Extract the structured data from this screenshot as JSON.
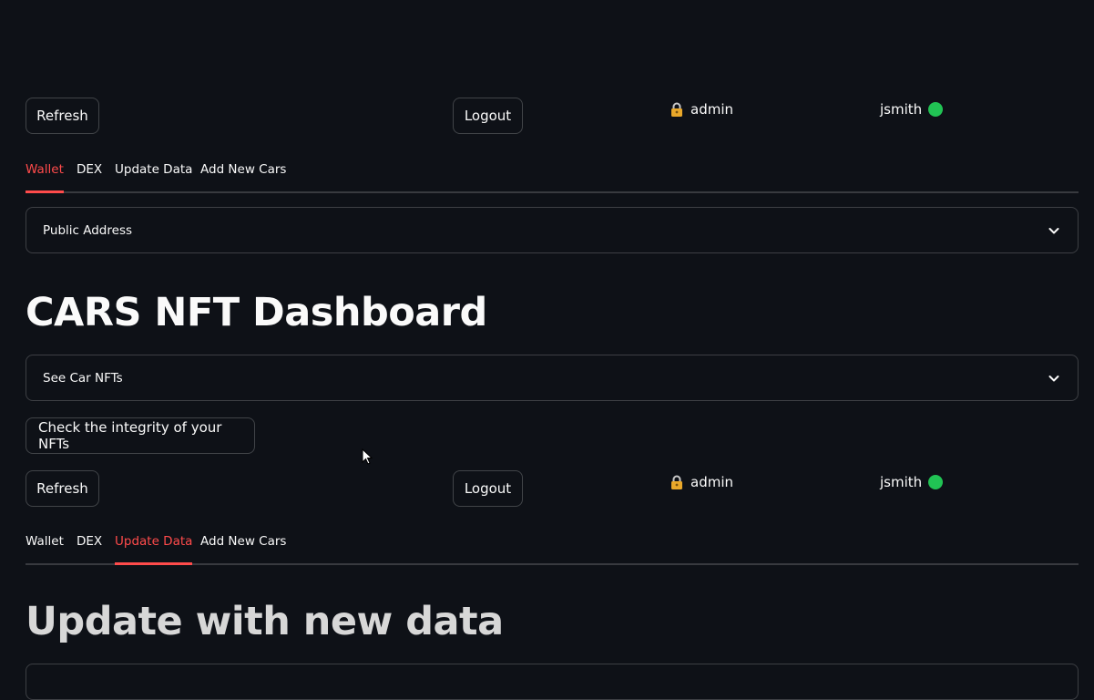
{
  "section1": {
    "refresh_label": "Refresh",
    "logout_label": "Logout",
    "role": "admin",
    "username": "jsmith",
    "tabs": [
      {
        "label": "Wallet"
      },
      {
        "label": "DEX"
      },
      {
        "label": "Update Data"
      },
      {
        "label": "Add New Cars"
      }
    ],
    "active_tab": "Wallet",
    "expander_public_address": "Public Address",
    "title": "CARS NFT Dashboard",
    "expander_see_car_nfts": "See Car NFTs",
    "check_integrity_label": "Check the integrity of your NFTs"
  },
  "section2": {
    "refresh_label": "Refresh",
    "logout_label": "Logout",
    "role": "admin",
    "username": "jsmith",
    "tabs": [
      {
        "label": "Wallet"
      },
      {
        "label": "DEX"
      },
      {
        "label": "Update Data"
      },
      {
        "label": "Add New Cars"
      }
    ],
    "active_tab": "Update Data",
    "title": "Update with new data"
  },
  "colors": {
    "background": "#0e1117",
    "accent": "#ff4b4b",
    "status_online": "#21c354",
    "lock": "#e9a82a"
  },
  "icons": {
    "lock": "lock-icon",
    "status": "online-status-icon",
    "chevron": "chevron-down-icon",
    "cursor": "mouse-cursor-icon"
  }
}
